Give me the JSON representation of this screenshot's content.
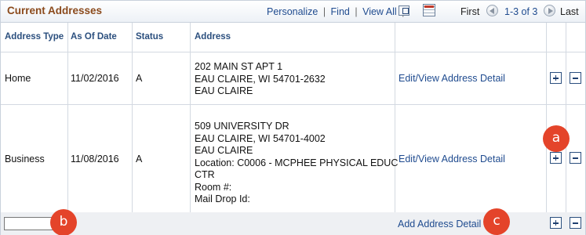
{
  "header": {
    "title": "Current Addresses",
    "personalize": "Personalize",
    "find": "Find",
    "view_all": "View All",
    "separator": "|",
    "first": "First",
    "range": "1-3 of 3",
    "last": "Last"
  },
  "columns": {
    "address_type": "Address Type",
    "as_of_date": "As Of Date",
    "status": "Status",
    "address": "Address"
  },
  "rows": [
    {
      "type": "Home",
      "date": "11/02/2016",
      "status": "A",
      "address": "202 MAIN ST APT 1\nEAU CLAIRE, WI 54701-2632\nEAU CLAIRE",
      "action": "Edit/View Address Detail"
    },
    {
      "type": "Business",
      "date": "11/08/2016",
      "status": "A",
      "address": "509 UNIVERSITY DR\nEAU CLAIRE, WI 54701-4002\nEAU CLAIRE\nLocation: C0006 - MCPHEE PHYSICAL EDUC\nCTR\nRoom #:\nMail Drop Id:",
      "action": "Edit/View Address Detail"
    }
  ],
  "new_row": {
    "action": "Add Address Detail"
  },
  "callouts": {
    "a": "a",
    "b": "b",
    "c": "c"
  },
  "icons": {
    "zoom": "zoom-grid-icon",
    "download": "download-spreadsheet-icon",
    "prev": "previous-circle-icon",
    "next": "next-circle-icon",
    "add": "add-row-icon",
    "delete": "delete-row-icon"
  },
  "colors": {
    "title": "#8b4a1c",
    "link": "#1f4b8f",
    "header_text": "#2b4f7e",
    "callout": "#e4442a"
  }
}
